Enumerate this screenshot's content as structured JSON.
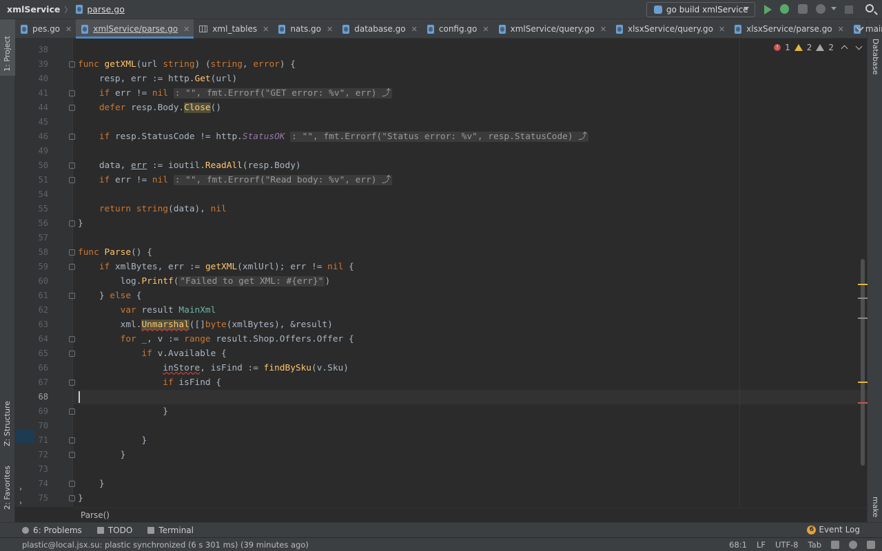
{
  "navbar": {
    "project": "xmlService",
    "file": "parse.go",
    "run_config": "go build xmlService"
  },
  "tabs": [
    {
      "label": "pes.go",
      "icon": "go-file-icon",
      "active": false
    },
    {
      "label": "xmlService/parse.go",
      "icon": "go-file-icon",
      "active": true
    },
    {
      "label": "xml_tables",
      "icon": "table-icon",
      "active": false
    },
    {
      "label": "nats.go",
      "icon": "go-file-icon",
      "active": false
    },
    {
      "label": "database.go",
      "icon": "go-file-icon",
      "active": false
    },
    {
      "label": "config.go",
      "icon": "go-file-icon",
      "active": false
    },
    {
      "label": "xmlService/query.go",
      "icon": "go-file-icon",
      "active": false
    },
    {
      "label": "xlsxService/query.go",
      "icon": "go-file-icon",
      "active": false
    },
    {
      "label": "xlsxService/parse.go",
      "icon": "go-file-icon",
      "active": false
    },
    {
      "label": "main.go",
      "icon": "go-file-icon",
      "active": false
    }
  ],
  "side_left": {
    "project": "1: Project",
    "structure": "Z: Structure",
    "favorites": "2: Favorites"
  },
  "side_right": {
    "database": "Database",
    "make": "make"
  },
  "inspections": {
    "errors": "1",
    "warnings": "2",
    "weak_warnings": "2"
  },
  "code": [
    {
      "n": "38",
      "html": ""
    },
    {
      "n": "39",
      "html": "<span class='kw'>func</span> <span class='fn'>getXML</span>(url <span class='kw'>string</span>) (<span class='kw'>string</span>, <span class='kw'>error</span>) {"
    },
    {
      "n": "40",
      "html": "    resp, err := http.<span class='fn'>Get</span>(url)"
    },
    {
      "n": "41",
      "html": "    <span class='kw'>if</span> err != <span class='kw'>nil</span> <span class='hint'>: \"\", fmt.Errorf(\"GET error: %v\", err) ⤴</span>"
    },
    {
      "n": "44",
      "html": "    <span class='kw'>defer</span> resp.Body.<span class='fn hlw'>Close</span>()"
    },
    {
      "n": "45",
      "html": ""
    },
    {
      "n": "46",
      "html": "    <span class='kw'>if</span> resp.StatusCode != http.<span class='italic'>StatusOK</span> <span class='hint'>: \"\", fmt.Errorf(\"Status error: %v\", resp.StatusCode) ⤴</span>"
    },
    {
      "n": "49",
      "html": ""
    },
    {
      "n": "50",
      "html": "    data, <span style='text-decoration:underline'>err</span> := ioutil.<span class='fn'>ReadAll</span>(resp.Body)"
    },
    {
      "n": "51",
      "html": "    <span class='kw'>if</span> err != <span class='kw'>nil</span> <span class='hint'>: \"\", fmt.Errorf(\"Read body: %v\", err) ⤴</span>"
    },
    {
      "n": "54",
      "html": ""
    },
    {
      "n": "55",
      "html": "    <span class='kw'>return</span> <span class='kw'>string</span>(data), <span class='kw'>nil</span>"
    },
    {
      "n": "56",
      "html": "}"
    },
    {
      "n": "57",
      "html": ""
    },
    {
      "n": "58",
      "html": "<span class='kw'>func</span> <span class='fn'>Parse</span>() {"
    },
    {
      "n": "59",
      "html": "    <span class='kw'>if</span> xmlBytes, err := <span class='fn'>getXML</span>(xmlUrl); err != <span class='kw'>nil</span> {"
    },
    {
      "n": "60",
      "html": "        log.<span class='fn'>Printf</span>(<span class='hint'>\"Failed to get XML: #{err}\"</span>)"
    },
    {
      "n": "61",
      "html": "    } <span class='kw'>else</span> {"
    },
    {
      "n": "62",
      "html": "        <span class='kw'>var</span> result <span class='type'>MainXml</span>"
    },
    {
      "n": "63",
      "html": "        xml.<span class='fn hlw squig'>Unmarshal</span>([]<span class='kw'>byte</span>(xmlBytes), &amp;result)"
    },
    {
      "n": "64",
      "html": "        <span class='kw'>for</span> _, v := <span class='kw'>range</span> result.Shop.Offers.Offer {"
    },
    {
      "n": "65",
      "html": "            <span class='kw'>if</span> v.Available {"
    },
    {
      "n": "66",
      "html": "                <span class='squig'>inStore</span>, isFind := <span class='fn'>findBySku</span>(v.Sku)"
    },
    {
      "n": "67",
      "html": "                <span class='kw'>if</span> isFind {"
    },
    {
      "n": "68",
      "html": ""
    },
    {
      "n": "69",
      "html": "                }"
    },
    {
      "n": "70",
      "html": ""
    },
    {
      "n": "71",
      "html": "            }"
    },
    {
      "n": "72",
      "html": "        }"
    },
    {
      "n": "73",
      "html": ""
    },
    {
      "n": "74",
      "html": "    }"
    },
    {
      "n": "75",
      "html": "}"
    }
  ],
  "current_line": "68",
  "breadcrumb_bottom": "Parse()",
  "toolwindows": {
    "problems": "6: Problems",
    "todo": "TODO",
    "terminal": "Terminal",
    "event_log": "Event Log",
    "event_count": "6"
  },
  "status": {
    "message": "plastic@local.jsx.su: plastic synchronized (6 s 301 ms) (39 minutes ago)",
    "position": "68:1",
    "line_sep": "LF",
    "encoding": "UTF-8",
    "indent": "Tab"
  },
  "colors": {
    "accent": "#4a88c7",
    "run_green": "#59a869",
    "error": "#c75450",
    "warning": "#e5b53f"
  }
}
